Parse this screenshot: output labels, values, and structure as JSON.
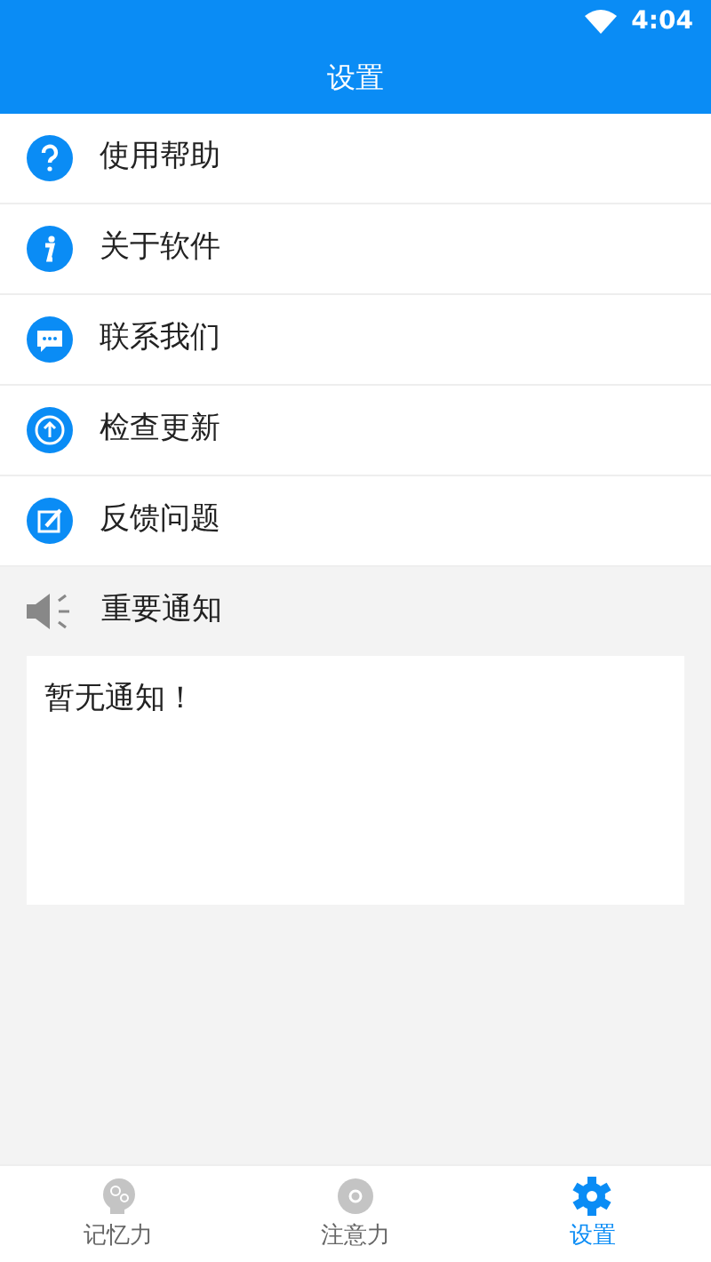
{
  "status_bar": {
    "time": "4:04"
  },
  "title": "设置",
  "menu": [
    {
      "kind": "help",
      "label": "使用帮助"
    },
    {
      "kind": "info",
      "label": "关于软件"
    },
    {
      "kind": "chat",
      "label": "联系我们"
    },
    {
      "kind": "update",
      "label": "检查更新"
    },
    {
      "kind": "feedback",
      "label": "反馈问题"
    }
  ],
  "notice": {
    "heading": "重要通知",
    "text": "暂无通知！"
  },
  "tabs": [
    {
      "kind": "brain",
      "label": "记忆力",
      "selected": false
    },
    {
      "kind": "disc",
      "label": "注意力",
      "selected": false
    },
    {
      "kind": "gear",
      "label": "设置",
      "selected": true
    }
  ]
}
